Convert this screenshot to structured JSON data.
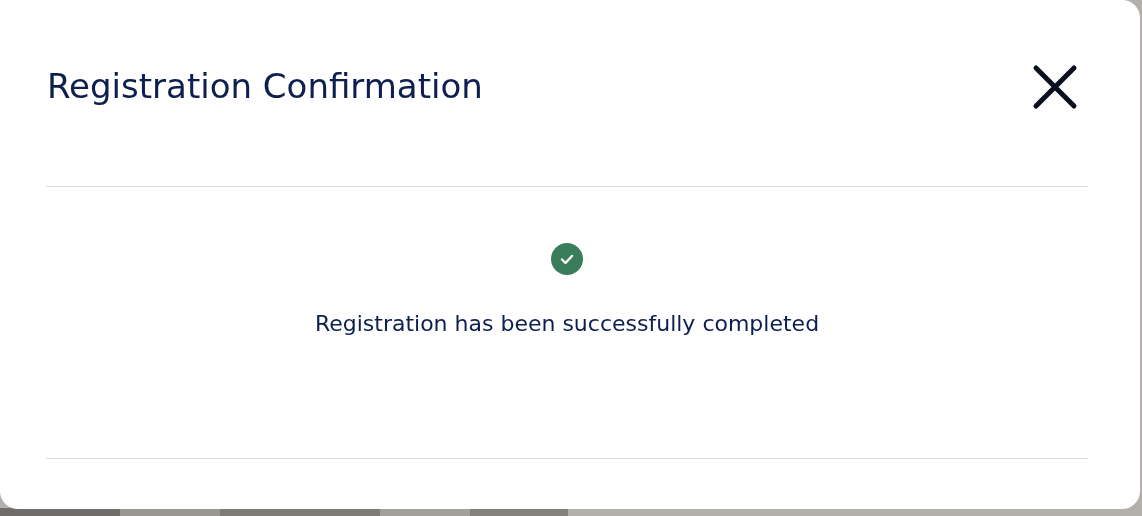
{
  "dialog": {
    "title": "Registration Confirmation",
    "message": "Registration has been successfully completed"
  }
}
